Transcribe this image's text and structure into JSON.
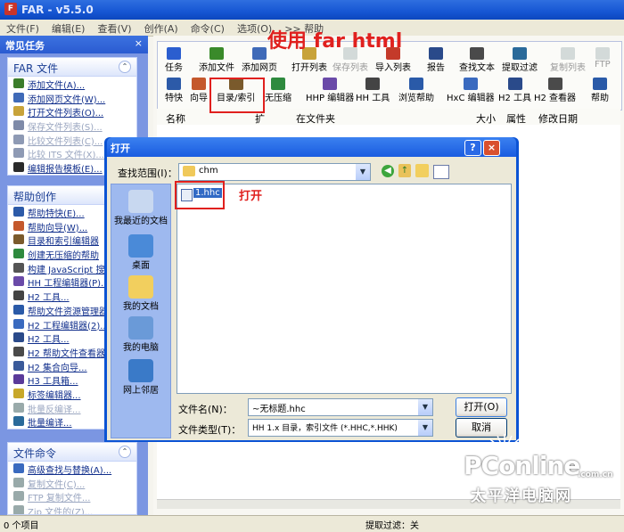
{
  "window": {
    "title": "FAR - v5.5.0"
  },
  "menu": [
    "文件(F)",
    "编辑(E)",
    "查看(V)",
    "创作(A)",
    "命令(C)",
    "选项(O)",
    ">> 帮助"
  ],
  "left_pane": {
    "header": "常见任务",
    "close": "×",
    "sections": [
      {
        "title": "FAR 文件",
        "items": [
          {
            "label": "添加文件(A)...",
            "enabled": true,
            "color": "#3b7d2b"
          },
          {
            "label": "添加网页文件(W)...",
            "enabled": true,
            "color": "#3f6ab8"
          },
          {
            "label": "打开文件列表(O)...",
            "enabled": true,
            "color": "#c8a33a"
          },
          {
            "label": "保存文件列表(S)...",
            "enabled": false,
            "color": "#7e8aa8"
          },
          {
            "label": "比较文件列表(C)...",
            "enabled": false,
            "color": "#8e9ab4"
          },
          {
            "label": "比较 ITS 文件(X)...",
            "enabled": false,
            "color": "#8e9ab4"
          },
          {
            "label": "编辑报告模板(E)...",
            "enabled": true,
            "color": "#2a2a2a"
          }
        ]
      },
      {
        "title": "帮助创作",
        "items": [
          {
            "label": "帮助特快(E)...",
            "enabled": true,
            "color": "#2c5aa8"
          },
          {
            "label": "帮助向导(W)...",
            "enabled": true,
            "color": "#c4582c"
          },
          {
            "label": "目录和索引编辑器",
            "enabled": true,
            "color": "#7a5a2c"
          },
          {
            "label": "创建无压缩的帮助",
            "enabled": true,
            "color": "#2e8a3e"
          },
          {
            "label": "构建 JavaScript 搜索",
            "enabled": true,
            "color": "#555"
          },
          {
            "label": "HH 工程编辑器(P)...",
            "enabled": true,
            "color": "#6a4aa8"
          },
          {
            "label": "H2 工具...",
            "enabled": true,
            "color": "#444"
          },
          {
            "label": "帮助文件资源管理器",
            "enabled": true,
            "color": "#2a5aa8"
          },
          {
            "label": "H2 工程编辑器(2)...",
            "enabled": true,
            "color": "#3a6abf"
          },
          {
            "label": "H2 工具...",
            "enabled": true,
            "color": "#2a4a8a"
          },
          {
            "label": "H2 帮助文件查看器",
            "enabled": true,
            "color": "#4a4a4a"
          },
          {
            "label": "H2 集合向导...",
            "enabled": true,
            "color": "#3a5a9a"
          },
          {
            "label": "H3 工具箱...",
            "enabled": true,
            "color": "#5a3a9a"
          },
          {
            "label": "标签编辑器...",
            "enabled": true,
            "color": "#c8a82a"
          },
          {
            "label": "批量反编译...",
            "enabled": false,
            "color": "#9aa"
          },
          {
            "label": "批量编译...",
            "enabled": true,
            "color": "#2a6a9a"
          }
        ]
      },
      {
        "title": "文件命令",
        "items": [
          {
            "label": "高级查找与替换(A)...",
            "enabled": true,
            "color": "#3a6abf"
          },
          {
            "label": "复制文件(C)...",
            "enabled": false,
            "color": "#9aa"
          },
          {
            "label": "FTP 复制文件...",
            "enabled": false,
            "color": "#9aa"
          },
          {
            "label": "Zip 文件的(Z)...",
            "enabled": false,
            "color": "#9aa"
          }
        ]
      }
    ]
  },
  "toolbar": {
    "row1": [
      {
        "label": "任务",
        "enabled": true,
        "color": "#2b5ecf"
      },
      {
        "label": "添加文件",
        "enabled": true,
        "color": "#3a8a2a"
      },
      {
        "label": "添加网页",
        "enabled": true,
        "color": "#3f6ab8"
      },
      {
        "label": "打开列表",
        "enabled": true,
        "color": "#c8a33a"
      },
      {
        "label": "保存列表",
        "enabled": false,
        "color": "#9aa"
      },
      {
        "label": "导入列表",
        "enabled": true,
        "color": "#c43a2a"
      },
      {
        "label": "报告",
        "enabled": true,
        "color": "#2a4a8a"
      },
      {
        "label": "查找文本",
        "enabled": true,
        "color": "#4a4a4a"
      },
      {
        "label": "提取过滤",
        "enabled": true,
        "color": "#2a6a9a"
      },
      {
        "label": "复制列表",
        "enabled": false,
        "color": "#9aa"
      },
      {
        "label": "FTP",
        "enabled": false,
        "color": "#9aa"
      }
    ],
    "row2": [
      {
        "label": "特快",
        "enabled": true,
        "color": "#2c5aa8"
      },
      {
        "label": "向导",
        "enabled": true,
        "color": "#c4582c"
      },
      {
        "label": "目录/索引",
        "enabled": true,
        "color": "#7a5a2c"
      },
      {
        "label": "无压缩",
        "enabled": true,
        "color": "#2e8a3e"
      },
      {
        "label": "HHP 编辑器",
        "enabled": true,
        "color": "#6a4aa8"
      },
      {
        "label": "HH 工具",
        "enabled": true,
        "color": "#444"
      },
      {
        "label": "浏览帮助",
        "enabled": true,
        "color": "#2a5aa8"
      },
      {
        "label": "HxC 编辑器",
        "enabled": true,
        "color": "#3a6abf"
      },
      {
        "label": "H2 工具",
        "enabled": true,
        "color": "#2a4a8a"
      },
      {
        "label": "H2 查看器",
        "enabled": true,
        "color": "#4a4a4a"
      },
      {
        "label": "帮助",
        "enabled": true,
        "color": "#2a5aa8"
      }
    ]
  },
  "columns": [
    "名称",
    "扩",
    "在文件夹",
    "大小",
    "属性",
    "修改日期"
  ],
  "status": {
    "items": "0 个项目",
    "filter": "提取过滤：关"
  },
  "dialog": {
    "title": "打开",
    "help": "?",
    "close": "×",
    "look_in_label": "查找范围(I)：",
    "look_in_value": "chm",
    "places": [
      "我最近的文档",
      "桌面",
      "我的文档",
      "我的电脑",
      "网上邻居"
    ],
    "file": "1.hhc",
    "filename_label": "文件名(N)：",
    "filename_value": "~无标题.hhc",
    "filetype_label": "文件类型(T)：",
    "filetype_value": "HH 1.x 目录，索引文件 (*.HHC,*.HHK)",
    "open_button": "打开(O)",
    "cancel_button": "取消"
  },
  "annotations": {
    "top": "使用 far html",
    "open": "打开"
  },
  "watermark": {
    "brand": "PConline",
    "domain": ".com.cn",
    "cn": "太平洋电脑网"
  }
}
